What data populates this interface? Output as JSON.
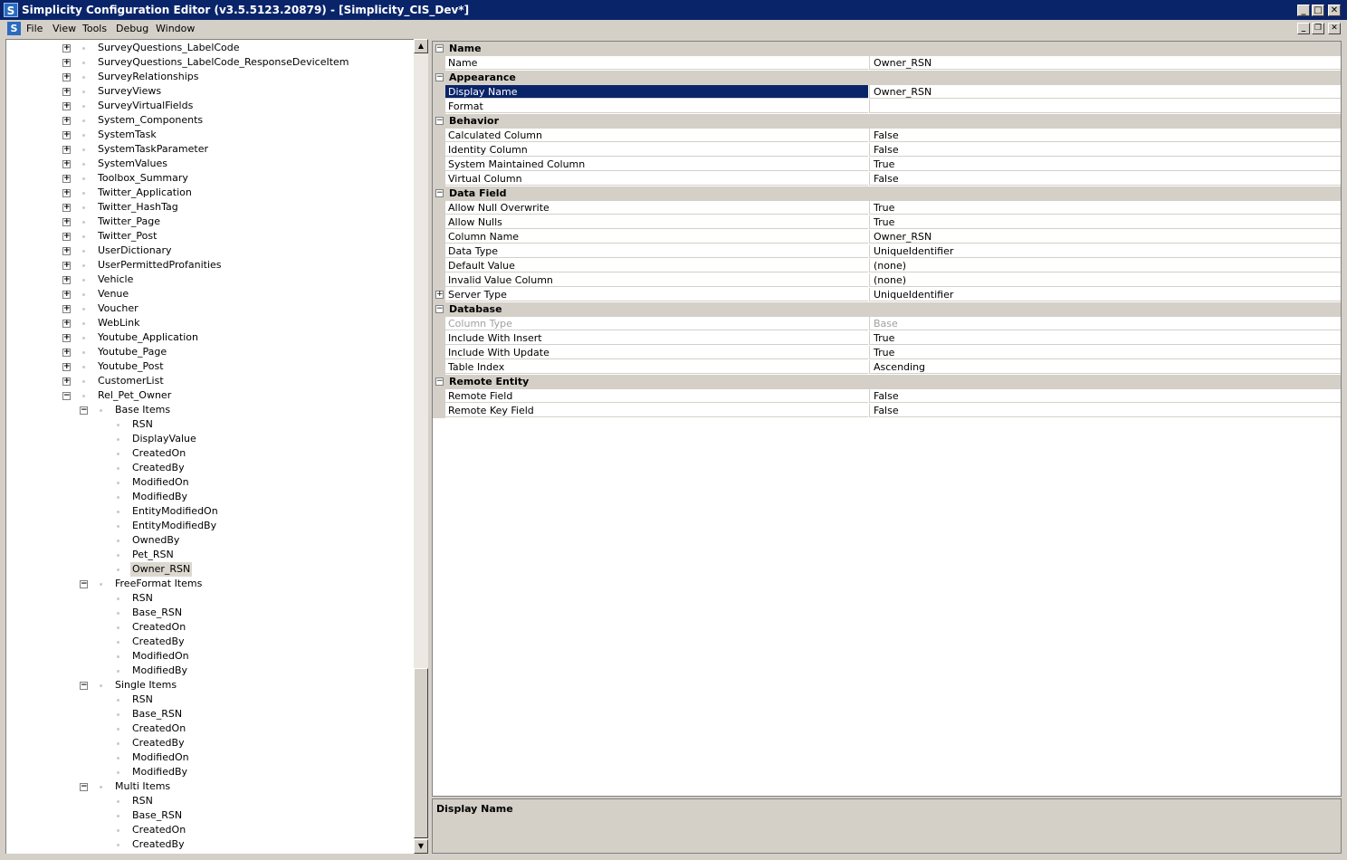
{
  "window": {
    "title": "Simplicity Configuration Editor (v3.5.5123.20879) - [Simplicity_CIS_Dev*]",
    "app_icon": "S",
    "controls": [
      "_",
      "□",
      "✕"
    ]
  },
  "menubar": {
    "icon": "S",
    "items": [
      "File",
      "View",
      "Tools",
      "Debug",
      "Window"
    ],
    "mdi_controls": [
      "_",
      "❐",
      "✕"
    ]
  },
  "tree": {
    "nodes": [
      {
        "label": "SurveyQuestions_LabelCode",
        "level": 0,
        "toggle": "+"
      },
      {
        "label": "SurveyQuestions_LabelCode_ResponseDeviceItem",
        "level": 0,
        "toggle": "+"
      },
      {
        "label": "SurveyRelationships",
        "level": 0,
        "toggle": "+"
      },
      {
        "label": "SurveyViews",
        "level": 0,
        "toggle": "+"
      },
      {
        "label": "SurveyVirtualFields",
        "level": 0,
        "toggle": "+"
      },
      {
        "label": "System_Components",
        "level": 0,
        "toggle": "+"
      },
      {
        "label": "SystemTask",
        "level": 0,
        "toggle": "+"
      },
      {
        "label": "SystemTaskParameter",
        "level": 0,
        "toggle": "+"
      },
      {
        "label": "SystemValues",
        "level": 0,
        "toggle": "+"
      },
      {
        "label": "Toolbox_Summary",
        "level": 0,
        "toggle": "+"
      },
      {
        "label": "Twitter_Application",
        "level": 0,
        "toggle": "+"
      },
      {
        "label": "Twitter_HashTag",
        "level": 0,
        "toggle": "+"
      },
      {
        "label": "Twitter_Page",
        "level": 0,
        "toggle": "+"
      },
      {
        "label": "Twitter_Post",
        "level": 0,
        "toggle": "+"
      },
      {
        "label": "UserDictionary",
        "level": 0,
        "toggle": "+"
      },
      {
        "label": "UserPermittedProfanities",
        "level": 0,
        "toggle": "+"
      },
      {
        "label": "Vehicle",
        "level": 0,
        "toggle": "+"
      },
      {
        "label": "Venue",
        "level": 0,
        "toggle": "+"
      },
      {
        "label": "Voucher",
        "level": 0,
        "toggle": "+"
      },
      {
        "label": "WebLink",
        "level": 0,
        "toggle": "+"
      },
      {
        "label": "Youtube_Application",
        "level": 0,
        "toggle": "+"
      },
      {
        "label": "Youtube_Page",
        "level": 0,
        "toggle": "+"
      },
      {
        "label": "Youtube_Post",
        "level": 0,
        "toggle": "+"
      },
      {
        "label": "CustomerList",
        "level": 0,
        "toggle": "+"
      },
      {
        "label": "Rel_Pet_Owner",
        "level": 0,
        "toggle": "−"
      },
      {
        "label": "Base Items",
        "level": 1,
        "toggle": "−"
      },
      {
        "label": "RSN",
        "level": 2,
        "toggle": ""
      },
      {
        "label": "DisplayValue",
        "level": 2,
        "toggle": ""
      },
      {
        "label": "CreatedOn",
        "level": 2,
        "toggle": ""
      },
      {
        "label": "CreatedBy",
        "level": 2,
        "toggle": ""
      },
      {
        "label": "ModifiedOn",
        "level": 2,
        "toggle": ""
      },
      {
        "label": "ModifiedBy",
        "level": 2,
        "toggle": ""
      },
      {
        "label": "EntityModifiedOn",
        "level": 2,
        "toggle": ""
      },
      {
        "label": "EntityModifiedBy",
        "level": 2,
        "toggle": ""
      },
      {
        "label": "OwnedBy",
        "level": 2,
        "toggle": ""
      },
      {
        "label": "Pet_RSN",
        "level": 2,
        "toggle": ""
      },
      {
        "label": "Owner_RSN",
        "level": 2,
        "toggle": "",
        "selected": true
      },
      {
        "label": "FreeFormat Items",
        "level": 1,
        "toggle": "−"
      },
      {
        "label": "RSN",
        "level": 2,
        "toggle": ""
      },
      {
        "label": "Base_RSN",
        "level": 2,
        "toggle": ""
      },
      {
        "label": "CreatedOn",
        "level": 2,
        "toggle": ""
      },
      {
        "label": "CreatedBy",
        "level": 2,
        "toggle": ""
      },
      {
        "label": "ModifiedOn",
        "level": 2,
        "toggle": ""
      },
      {
        "label": "ModifiedBy",
        "level": 2,
        "toggle": ""
      },
      {
        "label": "Single Items",
        "level": 1,
        "toggle": "−"
      },
      {
        "label": "RSN",
        "level": 2,
        "toggle": ""
      },
      {
        "label": "Base_RSN",
        "level": 2,
        "toggle": ""
      },
      {
        "label": "CreatedOn",
        "level": 2,
        "toggle": ""
      },
      {
        "label": "CreatedBy",
        "level": 2,
        "toggle": ""
      },
      {
        "label": "ModifiedOn",
        "level": 2,
        "toggle": ""
      },
      {
        "label": "ModifiedBy",
        "level": 2,
        "toggle": ""
      },
      {
        "label": "Multi Items",
        "level": 1,
        "toggle": "−"
      },
      {
        "label": "RSN",
        "level": 2,
        "toggle": ""
      },
      {
        "label": "Base_RSN",
        "level": 2,
        "toggle": ""
      },
      {
        "label": "CreatedOn",
        "level": 2,
        "toggle": ""
      },
      {
        "label": "CreatedBy",
        "level": 2,
        "toggle": ""
      }
    ]
  },
  "grid": {
    "rows": [
      {
        "kind": "cat",
        "name": "Name"
      },
      {
        "kind": "prop",
        "name": "Name",
        "value": "Owner_RSN"
      },
      {
        "kind": "cat",
        "name": "Appearance"
      },
      {
        "kind": "prop",
        "name": "Display Name",
        "value": "Owner_RSN",
        "selected": true
      },
      {
        "kind": "prop",
        "name": "Format",
        "value": ""
      },
      {
        "kind": "cat",
        "name": "Behavior"
      },
      {
        "kind": "prop",
        "name": "Calculated Column",
        "value": "False"
      },
      {
        "kind": "prop",
        "name": "Identity Column",
        "value": "False"
      },
      {
        "kind": "prop",
        "name": "System Maintained Column",
        "value": "True"
      },
      {
        "kind": "prop",
        "name": "Virtual Column",
        "value": "False"
      },
      {
        "kind": "cat",
        "name": "Data Field"
      },
      {
        "kind": "prop",
        "name": "Allow Null Overwrite",
        "value": "True"
      },
      {
        "kind": "prop",
        "name": "Allow Nulls",
        "value": "True"
      },
      {
        "kind": "prop",
        "name": "Column Name",
        "value": "Owner_RSN"
      },
      {
        "kind": "prop",
        "name": "Data Type",
        "value": "UniqueIdentifier"
      },
      {
        "kind": "prop",
        "name": "Default Value",
        "value": "(none)"
      },
      {
        "kind": "prop",
        "name": "Invalid Value Column",
        "value": "(none)"
      },
      {
        "kind": "prop",
        "name": "Server Type",
        "value": "UniqueIdentifier",
        "expandable": true
      },
      {
        "kind": "cat",
        "name": "Database"
      },
      {
        "kind": "prop",
        "name": "Column Type",
        "value": "Base",
        "disabled": true
      },
      {
        "kind": "prop",
        "name": "Include With Insert",
        "value": "True"
      },
      {
        "kind": "prop",
        "name": "Include With Update",
        "value": "True"
      },
      {
        "kind": "prop",
        "name": "Table Index",
        "value": "Ascending"
      },
      {
        "kind": "cat",
        "name": "Remote Entity"
      },
      {
        "kind": "prop",
        "name": "Remote Field",
        "value": "False"
      },
      {
        "kind": "prop",
        "name": "Remote Key Field",
        "value": "False"
      }
    ]
  },
  "description": {
    "title": "Display Name"
  },
  "colors": {
    "titlebar": "#0a246a",
    "selection": "#0a246a",
    "face": "#d4d0c8"
  }
}
